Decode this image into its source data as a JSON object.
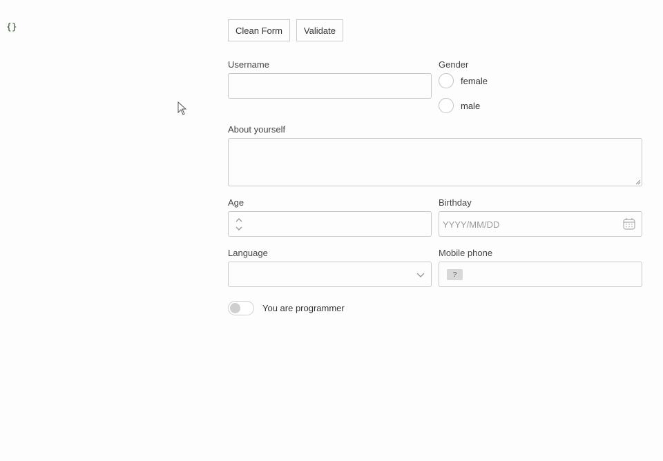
{
  "json_preview": "{}",
  "toolbar": {
    "clean_label": "Clean Form",
    "validate_label": "Validate"
  },
  "form": {
    "username": {
      "label": "Username",
      "value": ""
    },
    "gender": {
      "label": "Gender",
      "options": [
        "female",
        "male"
      ],
      "selected": null
    },
    "about": {
      "label": "About yourself",
      "value": ""
    },
    "age": {
      "label": "Age",
      "value": ""
    },
    "birthday": {
      "label": "Birthday",
      "placeholder": "YYYY/MM/DD"
    },
    "language": {
      "label": "Language",
      "selected": ""
    },
    "mobile": {
      "label": "Mobile phone",
      "flag": "?",
      "value": ""
    },
    "programmer": {
      "label": "You are programmer",
      "checked": false
    }
  }
}
